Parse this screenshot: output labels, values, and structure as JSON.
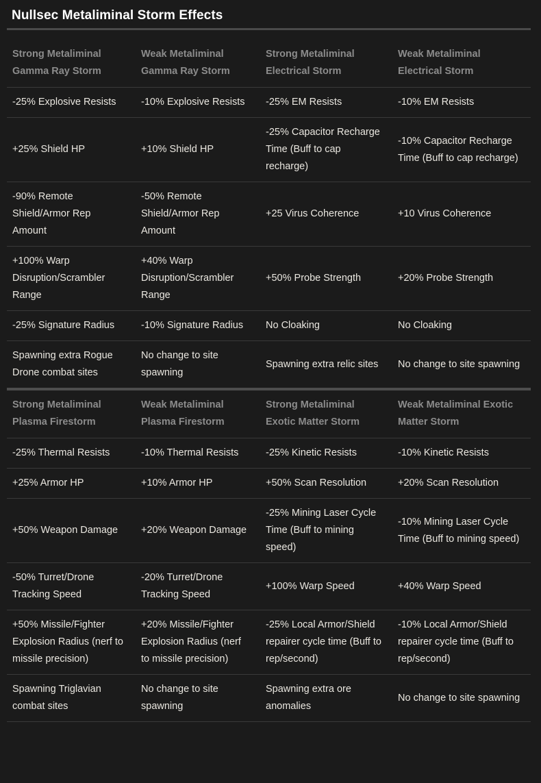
{
  "title": "Nullsec Metaliminal Storm Effects",
  "tables": [
    {
      "headers": [
        "Strong Metaliminal Gamma Ray Storm",
        "Weak Metaliminal Gamma Ray Storm",
        "Strong Metaliminal Electrical Storm",
        "Weak Metaliminal Electrical Storm"
      ],
      "rows": [
        [
          "-25% Explosive Resists",
          "-10% Explosive Resists",
          "-25% EM Resists",
          "-10% EM Resists"
        ],
        [
          "+25% Shield HP",
          "+10% Shield HP",
          "-25% Capacitor Recharge Time (Buff to cap recharge)",
          "-10% Capacitor Recharge Time (Buff to cap recharge)"
        ],
        [
          "-90% Remote Shield/Armor Rep Amount",
          "-50% Remote Shield/Armor Rep Amount",
          "+25 Virus Coherence",
          "+10 Virus Coherence"
        ],
        [
          "+100% Warp Disruption/Scrambler Range",
          "+40% Warp Disruption/Scrambler Range",
          "+50% Probe Strength",
          "+20% Probe Strength"
        ],
        [
          "-25% Signature Radius",
          "-10% Signature Radius",
          "No Cloaking",
          "No Cloaking"
        ],
        [
          "Spawning extra Rogue Drone combat sites",
          "No change to site spawning",
          "Spawning extra relic sites",
          "No change to site spawning"
        ]
      ]
    },
    {
      "headers": [
        "Strong Metaliminal Plasma Firestorm",
        "Weak Metaliminal Plasma Firestorm",
        "Strong Metaliminal Exotic Matter Storm",
        "Weak Metaliminal Exotic Matter Storm"
      ],
      "rows": [
        [
          "-25% Thermal Resists",
          "-10% Thermal Resists",
          "-25% Kinetic Resists",
          "-10% Kinetic Resists"
        ],
        [
          "+25% Armor HP",
          "+10% Armor HP",
          "+50% Scan Resolution",
          "+20% Scan Resolution"
        ],
        [
          "+50% Weapon Damage",
          "+20% Weapon Damage",
          "-25% Mining Laser Cycle Time (Buff to mining speed)",
          "-10% Mining Laser Cycle Time (Buff to mining speed)"
        ],
        [
          "-50% Turret/Drone Tracking Speed",
          "-20% Turret/Drone Tracking Speed",
          "+100% Warp Speed",
          "+40% Warp Speed"
        ],
        [
          "+50% Missile/Fighter Explosion Radius (nerf to missile precision)",
          "+20% Missile/Fighter Explosion Radius (nerf to missile precision)",
          "-25% Local Armor/Shield repairer cycle time (Buff to rep/second)",
          "-10% Local Armor/Shield repairer cycle time (Buff to rep/second)"
        ],
        [
          "Spawning Triglavian combat sites",
          "No change to site spawning",
          "Spawning extra ore anomalies",
          "No change to site spawning"
        ]
      ]
    }
  ],
  "colors": {
    "background": "#1b1b1b",
    "title_text": "#ffffff",
    "header_text": "#8c8c8c",
    "cell_text": "#eae7e0",
    "row_border": "#3a3a3a",
    "section_divider": "#4d4d4d"
  }
}
